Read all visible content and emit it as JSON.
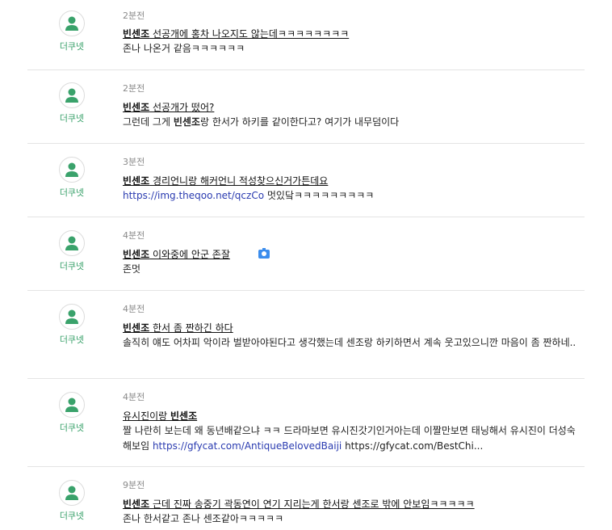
{
  "colors": {
    "nick": "#3aa26b",
    "avatar_icon": "#3aa26b",
    "link": "#2a3bb0",
    "separator": "#e4e4e4"
  },
  "icons": {
    "avatar": "user-icon",
    "photo": "camera-icon"
  },
  "comments": [
    {
      "nick": "더쿠넷",
      "time": "2분전",
      "title_bold": "빈센조",
      "title_rest": " 선공개에 홍차 나오지도 않는데ㅋㅋㅋㅋㅋㅋㅋㅋ",
      "body": "존나 나온거 같음ㅋㅋㅋㅋㅋㅋ"
    },
    {
      "nick": "더쿠넷",
      "time": "2분전",
      "title_bold": "빈센조",
      "title_rest": " 선공개가 떴어?",
      "body_a": "그런데 그게 ",
      "body_bold": "빈센조",
      "body_b": "랑 한서가 하키를 같이한다고? 여기가 내무덤이다"
    },
    {
      "nick": "더쿠넷",
      "time": "3분전",
      "title_bold": "빈센조",
      "title_rest": " 경리언니랑 해커언니 적성찾으신거가튼데요",
      "body_link": "https://img.theqoo.net/qczCo",
      "body_rest": " 멋있닼ㅋㅋㅋㅋㅋㅋㅋㅋㅋ"
    },
    {
      "nick": "더쿠넷",
      "time": "4분전",
      "title_bold": "빈센조",
      "title_rest": " 이와중에 안군 존잘",
      "body": "존멋"
    },
    {
      "nick": "더쿠넷",
      "time": "4분전",
      "title_bold": "빈센조",
      "title_rest": " 한서 좀 짠하긴 하다",
      "body": "솔직히 얘도 어차피 악이라 벌받아야된다고 생각했는데 센조랑 하키하면서 계속 웃고있으니깐 마음이 좀 짠하네.."
    },
    {
      "nick": "더쿠넷",
      "time": "4분전",
      "title_pre": "유시진이랑 ",
      "title_bold": "빈센조",
      "body_a": "짤 나란히 보는데 왜 동년배같으냐 ㅋㅋ 드라마보면 유시진갓기인거아는데 이짤만보면 태닝해서 유시진이 더성숙해보임 ",
      "body_link": "https://gfycat.com/AntiqueBelovedBaiji",
      "body_b": " https://gfycat.com/BestChi..."
    },
    {
      "nick": "더쿠넷",
      "time": "9분전",
      "title_bold": "빈센조",
      "title_rest": " 근데 진짜 송중기 곽동연이 연기 지리는게 한서랑 센조로 밖에 안보임ㅋㅋㅋㅋㅋ",
      "body": "존나 한서같고 존나 센조같아ㅋㅋㅋㅋㅋ"
    }
  ]
}
